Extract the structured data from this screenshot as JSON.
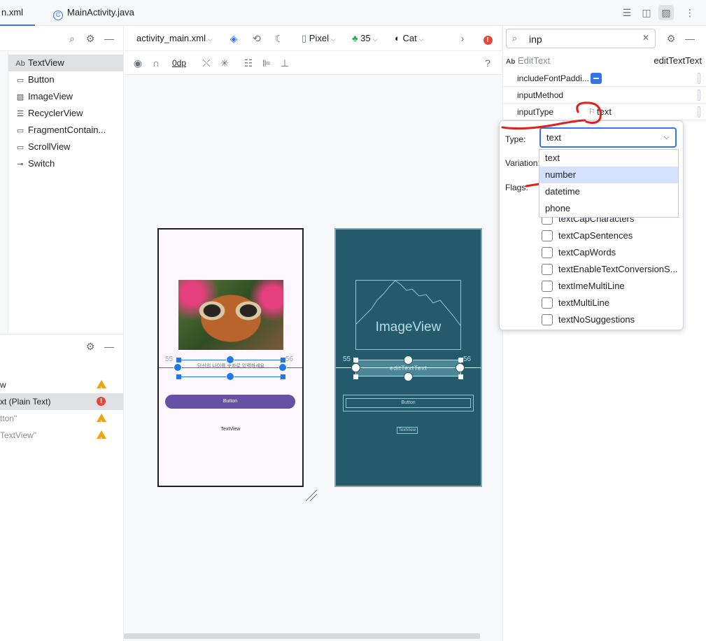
{
  "tabs": [
    {
      "label": "n.xml"
    },
    {
      "label": "MainActivity.java"
    }
  ],
  "palette": {
    "items": [
      {
        "icon": "Ab",
        "label": "TextView"
      },
      {
        "icon": "▭",
        "label": "Button"
      },
      {
        "icon": "▨",
        "label": "ImageView"
      },
      {
        "icon": "☰",
        "label": "RecyclerView"
      },
      {
        "icon": "▭",
        "label": "FragmentContain..."
      },
      {
        "icon": "▭",
        "label": "ScrollView"
      },
      {
        "icon": "⊸",
        "label": "Switch"
      }
    ]
  },
  "tree": {
    "rows": [
      {
        "label": "w",
        "status": "warning"
      },
      {
        "label": "xt (Plain Text)",
        "status": "error"
      },
      {
        "label": "tton\"",
        "status": "warning"
      },
      {
        "label": "TextView\"",
        "status": "warning"
      }
    ]
  },
  "design_toolbar": {
    "file": "activity_main.xml",
    "device": "Pixel",
    "api": "35",
    "theme": "Cat",
    "margin": "0dp"
  },
  "design_preview": {
    "edit_hint": "당신의 나이를 숫자로 입력하세요",
    "button_label": "Button",
    "textview_label": "TextView",
    "margin_left": "55",
    "margin_right": "56"
  },
  "blueprint_preview": {
    "imageview_label": "ImageView",
    "edittext_label": "editTextText",
    "button_label": "Button",
    "textview_label": "TextView",
    "margin_left": "55",
    "margin_right": "56"
  },
  "attributes": {
    "search_value": "inp",
    "component_type": "EditText",
    "component_id": "editTextText",
    "rows": [
      {
        "name": "includeFontPaddi..."
      },
      {
        "name": "inputMethod"
      },
      {
        "name": "inputType",
        "value": "text"
      }
    ]
  },
  "input_type_popup": {
    "type_label": "Type:",
    "variation_label": "Variation:",
    "flags_label": "Flags:",
    "type_selected": "text",
    "type_options": [
      "text",
      "number",
      "datetime",
      "phone"
    ],
    "highlighted_option": "number",
    "flags": [
      "textCapCharacters",
      "textCapSentences",
      "textCapWords",
      "textEnableTextConversionS...",
      "textImeMultiLine",
      "textMultiLine",
      "textNoSuggestions"
    ]
  },
  "colors": {
    "accent": "#3574f0",
    "blueprint": "#245a6c",
    "annotation": "#e0201c",
    "button": "#6750a4"
  }
}
